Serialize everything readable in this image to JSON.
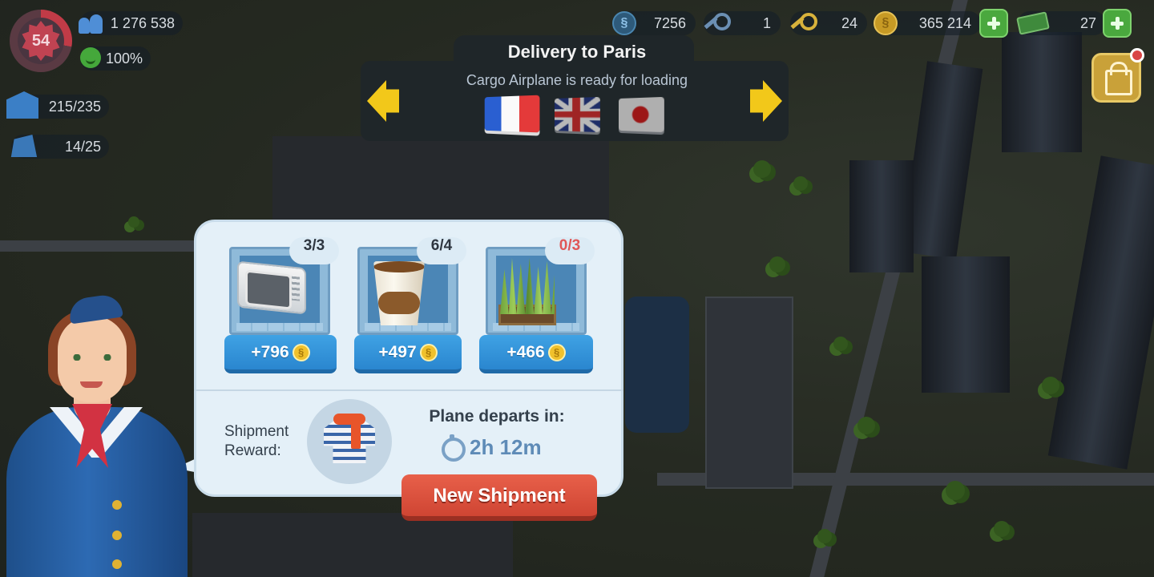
{
  "hud": {
    "level": "54",
    "population": "1 276 538",
    "happiness": "100%",
    "storage": "215/235",
    "housing": "14/25",
    "simcash_icon_letter": "§",
    "simcash": "7256",
    "golden_keys": "1",
    "platinum_keys": "24",
    "coin_icon_letter": "§",
    "simoleons": "365 214",
    "bills": "27"
  },
  "destination": {
    "title": "Delivery to Paris",
    "subtitle": "Cargo Airplane is ready for loading",
    "flags": [
      "france-flag",
      "uk-flag",
      "japan-flag"
    ],
    "selected_flag": "france-flag"
  },
  "shipment": {
    "items": [
      {
        "name": "microwave",
        "count": "3/3",
        "reward": "+796",
        "complete": true
      },
      {
        "name": "coffee",
        "count": "6/4",
        "reward": "+497",
        "complete": true
      },
      {
        "name": "grass",
        "count": "0/3",
        "reward": "+466",
        "complete": false
      }
    ],
    "reward_label": "Shipment Reward:",
    "reward_item": "sweater-scarf",
    "depart_label": "Plane departs in:",
    "timer": "2h 12m",
    "new_shipment_label": "New Shipment",
    "coin_letter": "§"
  },
  "colors": {
    "count_missing": "#e05858",
    "reward_button": "#2a86cf",
    "new_shipment_button": "#cf4533",
    "accent_arrow": "#f2c81a"
  }
}
